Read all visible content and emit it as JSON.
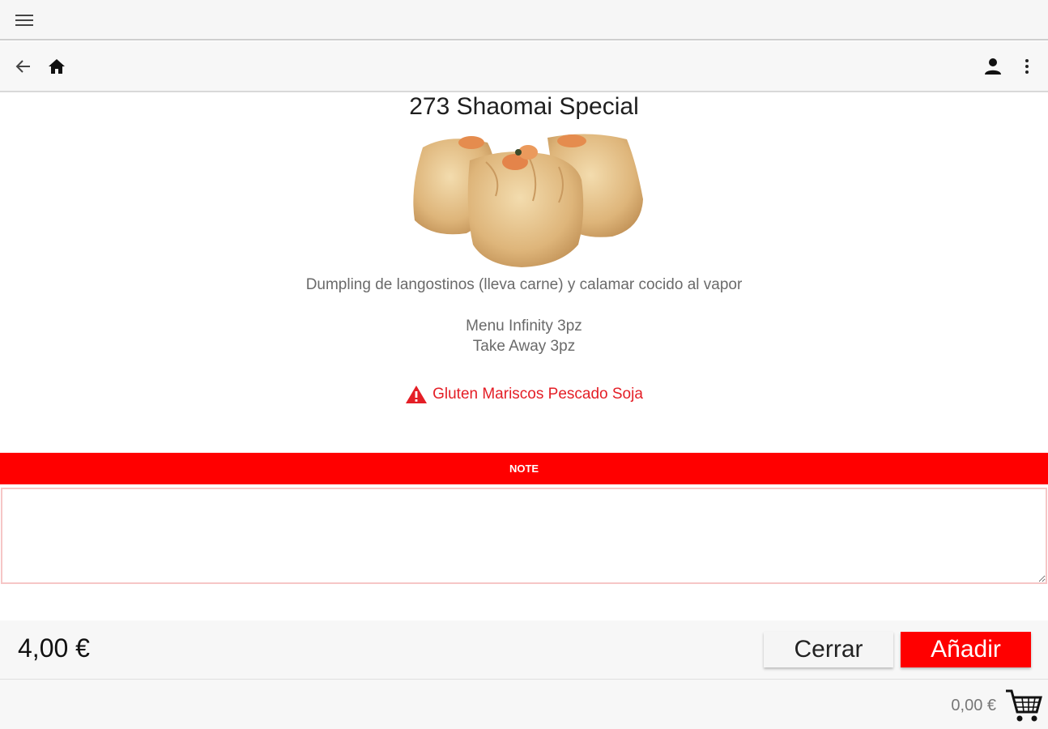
{
  "product": {
    "title": "273 Shaomai Special",
    "description": "Dumpling de langostinos (lleva carne) y calamar cocido al vapor",
    "variants": [
      "Menu Infinity 3pz",
      "Take Away 3pz"
    ],
    "allergens": "Gluten Mariscos Pescado Soja"
  },
  "note": {
    "label": "NOTE",
    "value": ""
  },
  "footer": {
    "price": "4,00 €",
    "close_label": "Cerrar",
    "add_label": "Añadir"
  },
  "cart": {
    "total": "0,00 €"
  },
  "icons": {
    "menu": "menu-icon",
    "back": "arrow-back-icon",
    "home": "home-icon",
    "account": "person-icon",
    "more": "more-vert-icon",
    "warning": "warning-icon",
    "cart": "cart-icon"
  },
  "colors": {
    "accent": "#ff0000",
    "warning_text": "#e41e26"
  }
}
